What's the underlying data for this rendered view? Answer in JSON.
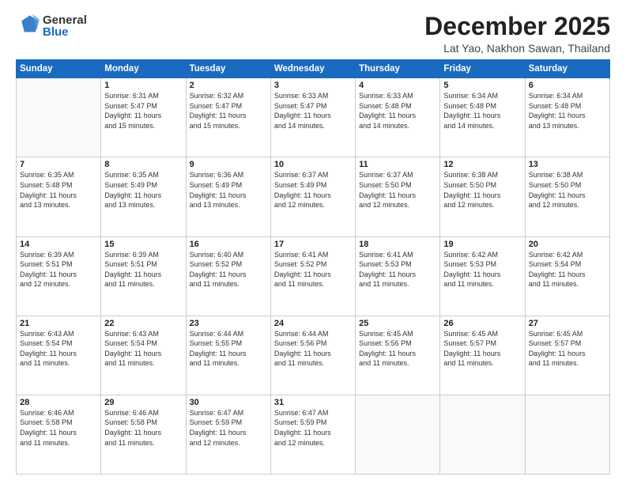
{
  "header": {
    "logo_line1": "General",
    "logo_line2": "Blue",
    "title": "December 2025",
    "subtitle": "Lat Yao, Nakhon Sawan, Thailand"
  },
  "calendar": {
    "days_of_week": [
      "Sunday",
      "Monday",
      "Tuesday",
      "Wednesday",
      "Thursday",
      "Friday",
      "Saturday"
    ],
    "weeks": [
      [
        {
          "day": "",
          "info": ""
        },
        {
          "day": "1",
          "info": "Sunrise: 6:31 AM\nSunset: 5:47 PM\nDaylight: 11 hours\nand 15 minutes."
        },
        {
          "day": "2",
          "info": "Sunrise: 6:32 AM\nSunset: 5:47 PM\nDaylight: 11 hours\nand 15 minutes."
        },
        {
          "day": "3",
          "info": "Sunrise: 6:33 AM\nSunset: 5:47 PM\nDaylight: 11 hours\nand 14 minutes."
        },
        {
          "day": "4",
          "info": "Sunrise: 6:33 AM\nSunset: 5:48 PM\nDaylight: 11 hours\nand 14 minutes."
        },
        {
          "day": "5",
          "info": "Sunrise: 6:34 AM\nSunset: 5:48 PM\nDaylight: 11 hours\nand 14 minutes."
        },
        {
          "day": "6",
          "info": "Sunrise: 6:34 AM\nSunset: 5:48 PM\nDaylight: 11 hours\nand 13 minutes."
        }
      ],
      [
        {
          "day": "7",
          "info": "Sunrise: 6:35 AM\nSunset: 5:48 PM\nDaylight: 11 hours\nand 13 minutes."
        },
        {
          "day": "8",
          "info": "Sunrise: 6:35 AM\nSunset: 5:49 PM\nDaylight: 11 hours\nand 13 minutes."
        },
        {
          "day": "9",
          "info": "Sunrise: 6:36 AM\nSunset: 5:49 PM\nDaylight: 11 hours\nand 13 minutes."
        },
        {
          "day": "10",
          "info": "Sunrise: 6:37 AM\nSunset: 5:49 PM\nDaylight: 11 hours\nand 12 minutes."
        },
        {
          "day": "11",
          "info": "Sunrise: 6:37 AM\nSunset: 5:50 PM\nDaylight: 11 hours\nand 12 minutes."
        },
        {
          "day": "12",
          "info": "Sunrise: 6:38 AM\nSunset: 5:50 PM\nDaylight: 11 hours\nand 12 minutes."
        },
        {
          "day": "13",
          "info": "Sunrise: 6:38 AM\nSunset: 5:50 PM\nDaylight: 11 hours\nand 12 minutes."
        }
      ],
      [
        {
          "day": "14",
          "info": "Sunrise: 6:39 AM\nSunset: 5:51 PM\nDaylight: 11 hours\nand 12 minutes."
        },
        {
          "day": "15",
          "info": "Sunrise: 6:39 AM\nSunset: 5:51 PM\nDaylight: 11 hours\nand 11 minutes."
        },
        {
          "day": "16",
          "info": "Sunrise: 6:40 AM\nSunset: 5:52 PM\nDaylight: 11 hours\nand 11 minutes."
        },
        {
          "day": "17",
          "info": "Sunrise: 6:41 AM\nSunset: 5:52 PM\nDaylight: 11 hours\nand 11 minutes."
        },
        {
          "day": "18",
          "info": "Sunrise: 6:41 AM\nSunset: 5:53 PM\nDaylight: 11 hours\nand 11 minutes."
        },
        {
          "day": "19",
          "info": "Sunrise: 6:42 AM\nSunset: 5:53 PM\nDaylight: 11 hours\nand 11 minutes."
        },
        {
          "day": "20",
          "info": "Sunrise: 6:42 AM\nSunset: 5:54 PM\nDaylight: 11 hours\nand 11 minutes."
        }
      ],
      [
        {
          "day": "21",
          "info": "Sunrise: 6:43 AM\nSunset: 5:54 PM\nDaylight: 11 hours\nand 11 minutes."
        },
        {
          "day": "22",
          "info": "Sunrise: 6:43 AM\nSunset: 5:54 PM\nDaylight: 11 hours\nand 11 minutes."
        },
        {
          "day": "23",
          "info": "Sunrise: 6:44 AM\nSunset: 5:55 PM\nDaylight: 11 hours\nand 11 minutes."
        },
        {
          "day": "24",
          "info": "Sunrise: 6:44 AM\nSunset: 5:56 PM\nDaylight: 11 hours\nand 11 minutes."
        },
        {
          "day": "25",
          "info": "Sunrise: 6:45 AM\nSunset: 5:56 PM\nDaylight: 11 hours\nand 11 minutes."
        },
        {
          "day": "26",
          "info": "Sunrise: 6:45 AM\nSunset: 5:57 PM\nDaylight: 11 hours\nand 11 minutes."
        },
        {
          "day": "27",
          "info": "Sunrise: 6:45 AM\nSunset: 5:57 PM\nDaylight: 11 hours\nand 11 minutes."
        }
      ],
      [
        {
          "day": "28",
          "info": "Sunrise: 6:46 AM\nSunset: 5:58 PM\nDaylight: 11 hours\nand 11 minutes."
        },
        {
          "day": "29",
          "info": "Sunrise: 6:46 AM\nSunset: 5:58 PM\nDaylight: 11 hours\nand 11 minutes."
        },
        {
          "day": "30",
          "info": "Sunrise: 6:47 AM\nSunset: 5:59 PM\nDaylight: 11 hours\nand 12 minutes."
        },
        {
          "day": "31",
          "info": "Sunrise: 6:47 AM\nSunset: 5:59 PM\nDaylight: 11 hours\nand 12 minutes."
        },
        {
          "day": "",
          "info": ""
        },
        {
          "day": "",
          "info": ""
        },
        {
          "day": "",
          "info": ""
        }
      ]
    ]
  }
}
